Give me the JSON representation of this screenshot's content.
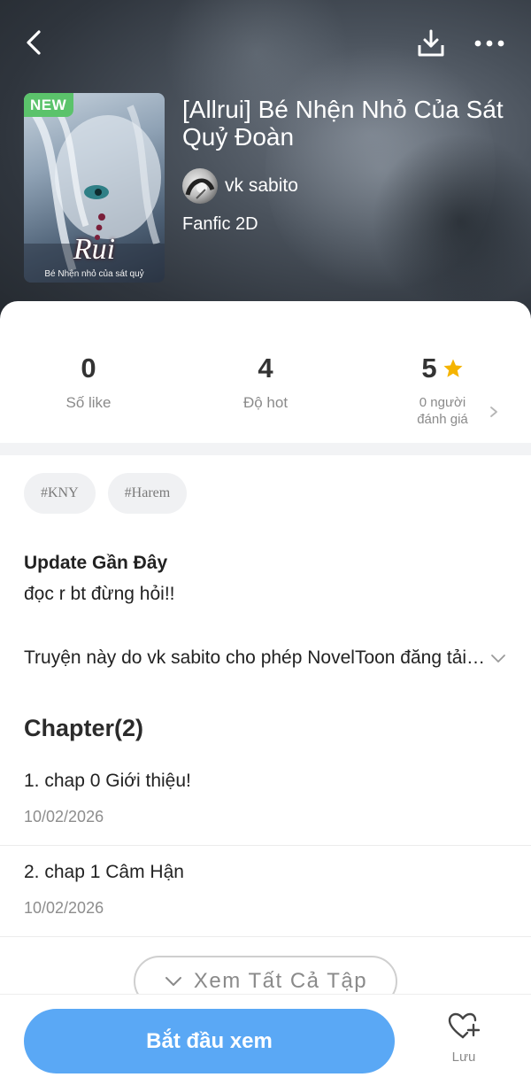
{
  "header": {
    "badge": "NEW",
    "cover_title": "Rui",
    "cover_subtitle": "Bé Nhện nhỏ của sát quỷ",
    "title": "[Allrui] Bé Nhện Nhỏ Của Sát Quỷ Đoàn",
    "author": "vk sabito",
    "genre": "Fanfic 2D",
    "icons": [
      "back-icon",
      "download-icon",
      "more-icon"
    ]
  },
  "stats": {
    "likes": {
      "value": "0",
      "label": "Số like"
    },
    "hot": {
      "value": "4",
      "label": "Độ hot"
    },
    "rating": {
      "value": "5",
      "label_line1": "0 người",
      "label_line2": "đánh giá"
    }
  },
  "tags": [
    "#KNY",
    "#Harem"
  ],
  "update": {
    "title": "Update Gần Đây",
    "text": "đọc r bt đừng hỏi!!"
  },
  "description": "Truyện này do vk sabito cho phép NovelToon đăng tải độc quyền",
  "chapters": {
    "heading": "Chapter(2)",
    "items": [
      {
        "name": "1. chap 0 Giới thiệu!",
        "date": "10/02/2026"
      },
      {
        "name": "2. chap 1 Câm Hận",
        "date": "10/02/2026"
      }
    ],
    "view_all": "Xem Tất Cả Tập"
  },
  "bottom": {
    "start_label": "Bắt đầu xem",
    "save_label": "Lưu"
  },
  "colors": {
    "primary": "#5aa8f5",
    "badge": "#5bc36b",
    "star": "#f5b400"
  }
}
